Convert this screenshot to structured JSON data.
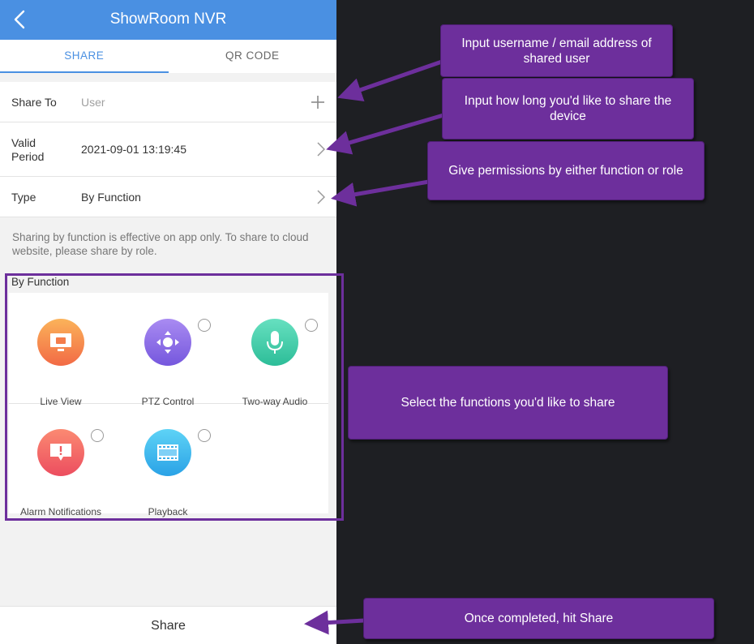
{
  "header": {
    "title": "ShowRoom NVR"
  },
  "tabs": [
    {
      "label": "SHARE",
      "active": true
    },
    {
      "label": "QR CODE",
      "active": false
    }
  ],
  "form": {
    "share_to_label": "Share To",
    "share_to_placeholder": "User",
    "valid_label_line1": "Valid",
    "valid_label_line2": "Period",
    "valid_value": "2021-09-01 13:19:45",
    "type_label": "Type",
    "type_value": "By Function"
  },
  "hint": "Sharing by function is effective on app only. To share to cloud website, please share by role.",
  "section_title": "By Function",
  "functions": [
    {
      "name": "Live View",
      "icon": "monitor-icon",
      "color_top": "#fbb35a",
      "color_bottom": "#f26a45",
      "has_radio": false
    },
    {
      "name": "PTZ Control",
      "icon": "ptz-direction-icon",
      "color_top": "#a98bf2",
      "color_bottom": "#7557dd",
      "has_radio": true
    },
    {
      "name": "Two-way Audio",
      "icon": "microphone-icon",
      "color_top": "#67e0c0",
      "color_bottom": "#2dbd98",
      "has_radio": true
    },
    {
      "name": "Alarm Notifications",
      "icon": "alarm-alert-icon",
      "color_top": "#fb8a72",
      "color_bottom": "#ec4d5f",
      "has_radio": true
    },
    {
      "name": "Playback",
      "icon": "film-icon",
      "color_top": "#5ed3f6",
      "color_bottom": "#2aa2e6",
      "has_radio": true
    }
  ],
  "share_button": "Share",
  "annotations": {
    "username": "Input username / email address of shared user",
    "duration": "Input how long you'd like to share the device",
    "permissions": "Give permissions by either function or role",
    "functions": "Select the functions you'd like to share",
    "share": "Once completed, hit Share"
  },
  "colors": {
    "primary_blue": "#4a90e2",
    "annotation_purple": "#6d2f9c",
    "background_dark": "#1e1f23"
  }
}
